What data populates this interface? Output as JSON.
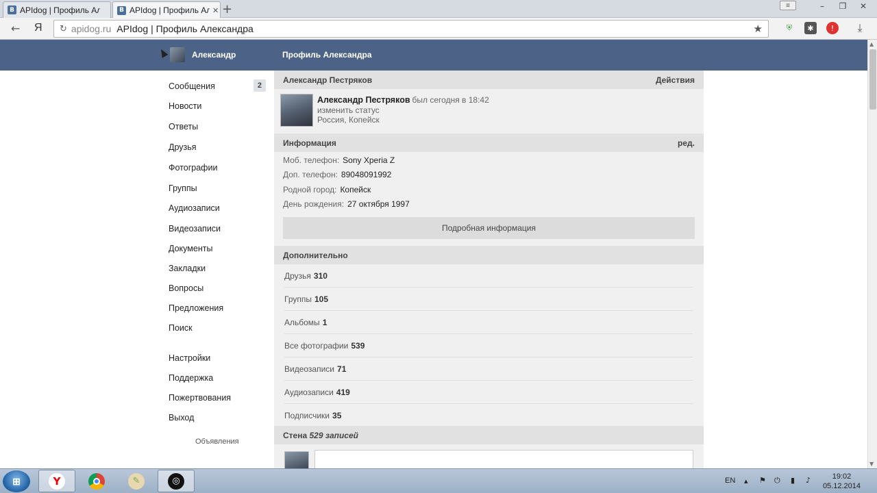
{
  "browser": {
    "tabs": [
      {
        "favicon": "В",
        "title": "APIdog | Профиль Але",
        "active": false
      },
      {
        "favicon": "В",
        "title": "APIdog | Профиль Ал",
        "active": true
      }
    ],
    "address_domain": "apidog.ru",
    "address_title": "APIdog | Профиль Александра",
    "yandex_glyph": "Я"
  },
  "header": {
    "user_name": "Александр",
    "page_title": "Профиль Александра"
  },
  "menu": {
    "items": [
      {
        "label": "Сообщения",
        "badge": "2"
      },
      {
        "label": "Новости"
      },
      {
        "label": "Ответы"
      },
      {
        "label": "Друзья"
      },
      {
        "label": "Фотографии"
      },
      {
        "label": "Группы"
      },
      {
        "label": "Аудиозаписи"
      },
      {
        "label": "Видеозаписи"
      },
      {
        "label": "Документы"
      },
      {
        "label": "Закладки"
      },
      {
        "label": "Вопросы"
      },
      {
        "label": "Предложения"
      },
      {
        "label": "Поиск"
      },
      {
        "label": "Настройки"
      },
      {
        "label": "Поддержка"
      },
      {
        "label": "Пожертвования"
      },
      {
        "label": "Выход"
      }
    ],
    "ads": "Объявления"
  },
  "profile": {
    "header_name": "Александр Пестряков",
    "actions": "Действия",
    "name": "Александр Пестряков",
    "last_seen": "был сегодня в 18:42",
    "status": "изменить статус",
    "location": "Россия, Копейск"
  },
  "info": {
    "title": "Информация",
    "edit": "ред.",
    "rows": [
      {
        "label": "Моб. телефон:",
        "value": "Sony Xperia Z"
      },
      {
        "label": "Доп. телефон:",
        "value": "89048091992"
      },
      {
        "label": "Родной город:",
        "value": "Копейск"
      },
      {
        "label": "День рождения:",
        "value": "27 октября 1997"
      }
    ],
    "more_button": "Подробная информация"
  },
  "extra": {
    "title": "Дополнительно",
    "stats": [
      {
        "label": "Друзья",
        "count": "310"
      },
      {
        "label": "Группы",
        "count": "105"
      },
      {
        "label": "Альбомы",
        "count": "1"
      },
      {
        "label": "Все фотографии",
        "count": "539"
      },
      {
        "label": "Видеозаписи",
        "count": "71"
      },
      {
        "label": "Аудиозаписи",
        "count": "419"
      },
      {
        "label": "Подписчики",
        "count": "35"
      }
    ]
  },
  "wall": {
    "title": "Стена",
    "count": "529 записей"
  },
  "taskbar": {
    "language": "EN",
    "time": "19:02",
    "date": "05.12.2014"
  },
  "colors": {
    "header_bg": "#4c6387",
    "main_bg": "#f0f0f0",
    "section_header_bg": "#e1e1e1"
  }
}
